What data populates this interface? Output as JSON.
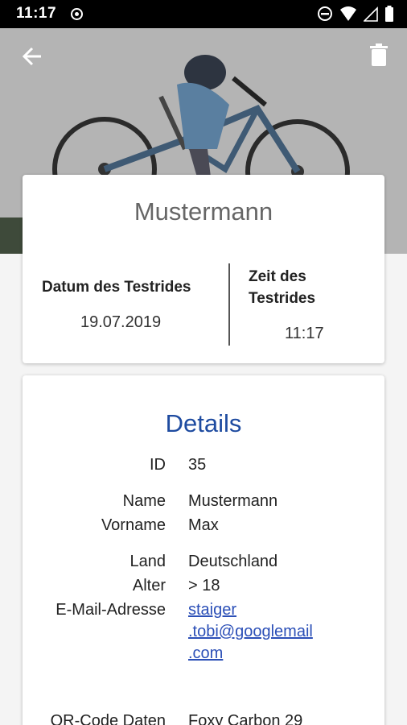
{
  "status_bar": {
    "time": "11:17"
  },
  "header": {
    "back_icon": "arrow-back-icon",
    "delete_icon": "trash-icon"
  },
  "summary": {
    "title": "Mustermann",
    "date_label": "Datum des Testrides",
    "date_value": "19.07.2019",
    "time_label_line1": "Zeit des",
    "time_label_line2": "Testrides",
    "time_value": "11:17"
  },
  "details": {
    "title": "Details",
    "rows": [
      {
        "label": "ID",
        "value": "35"
      },
      {
        "label": "Name",
        "value": "Mustermann"
      },
      {
        "label": "Vorname",
        "value": "Max"
      },
      {
        "label": "Land",
        "value": "Deutschland"
      },
      {
        "label": "Alter",
        "value": "> 18"
      },
      {
        "label": "E-Mail-Adresse",
        "value_lines": [
          "staiger",
          ".tobi@googlemail",
          ".com"
        ]
      },
      {
        "label": "QR-Code Daten",
        "value": "Foxy Carbon 29"
      }
    ]
  }
}
